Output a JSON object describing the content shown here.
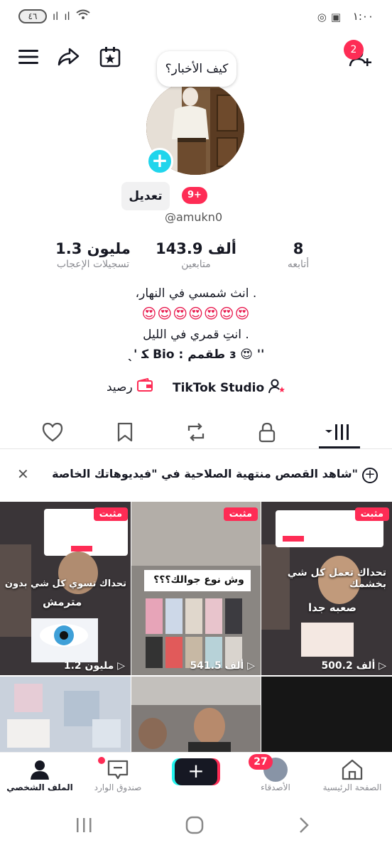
{
  "status_bar": {
    "time": "١:٠٠",
    "battery": "٤٦"
  },
  "top_bar": {
    "notification_count": "2"
  },
  "profile": {
    "bubble_text": "كيف الأخبار؟",
    "edit_label": "تعديل",
    "notif_badge": "9+",
    "username": "@amukn0"
  },
  "stats": {
    "likes_value": "1.3 مليون",
    "likes_label": "تسجيلات الإعجاب",
    "followers_value": "143.9 ألف",
    "followers_label": "متابعين",
    "following_value": "8",
    "following_label": "أتابعه"
  },
  "bio": {
    "line1": "،انث شمسي في النهار .",
    "line2": "😍😍😍😍😍😍😍",
    "line3": "انتِ قمري في الليل .",
    "line4": "ˎ' ﻜ Bio : طقمم ɜ 😍 ''"
  },
  "links": {
    "studio": "TikTok Studio",
    "balance": "رصيد"
  },
  "stories_banner": {
    "text": "شاهد القصص منتهية الصلاحية في \"فيديوهاتك الخاصة\""
  },
  "videos": [
    {
      "pinned": "مثبت",
      "views": "500.2 ألف",
      "caption": "تحداك تعمل كل شي بخشمك",
      "sub": "صعبه جدا"
    },
    {
      "pinned": "مثبت",
      "views": "541.5 ألف",
      "caption": "وش نوع جوالك؟؟؟"
    },
    {
      "pinned": "مثبت",
      "views": "1.2 مليون",
      "caption": "تحداك تسوي كل شي بدون",
      "sub": "مترمش"
    }
  ],
  "bottom_nav": {
    "home": "الصفحة الرئيسية",
    "friends": "الأصدقاء",
    "friends_badge": "27",
    "inbox": "صندوق الوارد",
    "profile": "الملف الشخصي"
  }
}
